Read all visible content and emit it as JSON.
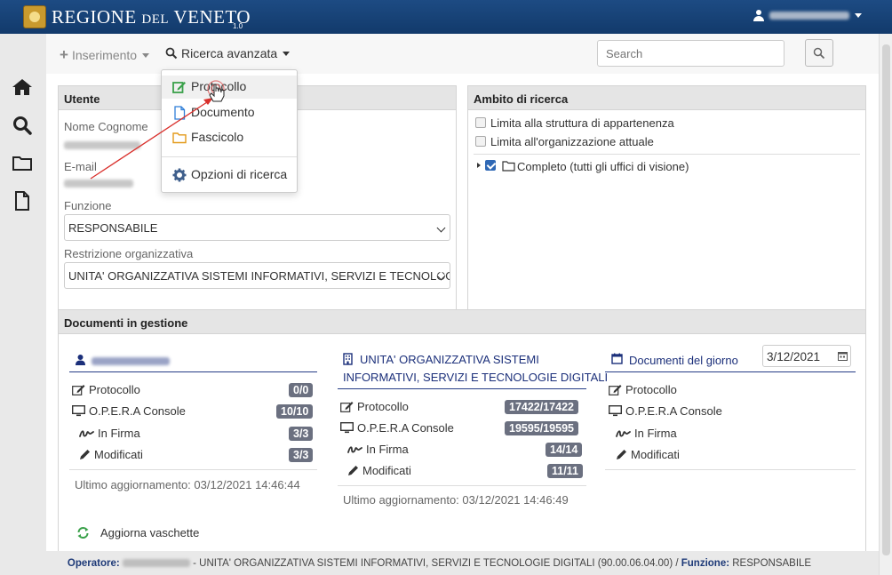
{
  "header": {
    "brand_main": "REGIONE",
    "brand_small": "DEL",
    "brand_end": "VENETO",
    "version": "1.0"
  },
  "toolbar": {
    "insert_label": "Inserimento",
    "advanced_search_label": "Ricerca avanzata",
    "search_placeholder": "Search"
  },
  "dropdown": {
    "items": [
      {
        "label": "Protocollo",
        "icon": "edit-icon"
      },
      {
        "label": "Documento",
        "icon": "file-icon"
      },
      {
        "label": "Fascicolo",
        "icon": "folder-icon"
      },
      {
        "label": "Opzioni di ricerca",
        "icon": "gear-icon"
      }
    ]
  },
  "user_panel": {
    "title": "Utente",
    "name_label": "Nome Cognome",
    "email_label": "E-mail",
    "function_label": "Funzione",
    "function_value": "RESPONSABILE",
    "restriction_label": "Restrizione organizzativa",
    "restriction_value": "UNITA' ORGANIZZATIVA SISTEMI INFORMATIVI, SERVIZI E TECNOLOGIE DIGITALI"
  },
  "scope_panel": {
    "title": "Ambito di ricerca",
    "option1": "Limita alla struttura di appartenenza",
    "option2": "Limita all'organizzazione attuale",
    "tree_root": "Completo (tutti gli uffici di visione)"
  },
  "documents": {
    "title": "Documenti in gestione",
    "refresh_label": "Aggiorna vaschette",
    "user_col": {
      "rows": [
        {
          "label": "Protocollo",
          "count": "0/0"
        },
        {
          "label": "O.P.E.R.A Console",
          "count": "10/10"
        },
        {
          "label": "In Firma",
          "count": "3/3"
        },
        {
          "label": "Modificati",
          "count": "3/3"
        }
      ],
      "updated": "Ultimo aggiornamento: 03/12/2021 14:46:44"
    },
    "unit_col": {
      "title_line1": "UNITA' ORGANIZZATIVA SISTEMI",
      "title_line2": "INFORMATIVI, SERVIZI E TECNOLOGIE DIGITALI",
      "rows": [
        {
          "label": "Protocollo",
          "count": "17422/17422"
        },
        {
          "label": "O.P.E.R.A Console",
          "count": "19595/19595"
        },
        {
          "label": "In Firma",
          "count": "14/14"
        },
        {
          "label": "Modificati",
          "count": "11/11"
        }
      ],
      "updated": "Ultimo aggiornamento: 03/12/2021 14:46:49"
    },
    "day_col": {
      "title": "Documenti del giorno",
      "date": "3/12/2021",
      "rows": [
        {
          "label": "Protocollo"
        },
        {
          "label": "O.P.E.R.A Console"
        },
        {
          "label": "In Firma"
        },
        {
          "label": "Modificati"
        }
      ]
    }
  },
  "footer": {
    "operator_label": "Operatore:",
    "unit_text": "- UNITA' ORGANIZZATIVA SISTEMI INFORMATIVI, SERVIZI E TECNOLOGIE DIGITALI (90.00.06.04.00) /",
    "function_label": "Funzione:",
    "function_value": "RESPONSABILE"
  }
}
